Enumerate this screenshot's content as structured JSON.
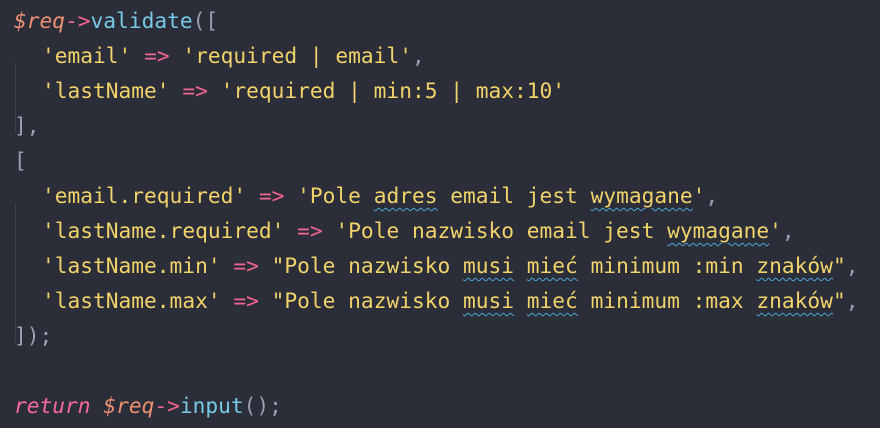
{
  "code": {
    "l1": {
      "var": "$req",
      "arrow": "->",
      "method": "validate",
      "open": "(["
    },
    "l2": {
      "key": "'email'",
      "arrow": "=>",
      "value": "'required | email'",
      "comma": ","
    },
    "l3": {
      "key": "'lastName'",
      "arrow": "=>",
      "value": "'required | min:5 | max:10'"
    },
    "l4": {
      "close": "],"
    },
    "l5": {
      "open": "["
    },
    "l6": {
      "key": "'email.required'",
      "arrow": "=>",
      "value_pre": "'Pole ",
      "value_sq1": "adres",
      "value_mid": " email jest ",
      "value_sq2": "wymagane",
      "value_end": "'",
      "comma": ","
    },
    "l7": {
      "key": "'lastName.required'",
      "arrow": "=>",
      "value_pre": "'Pole nazwisko email jest ",
      "value_sq1": "wymagane",
      "value_end": "'",
      "comma": ","
    },
    "l8": {
      "key": "'lastName.min'",
      "arrow": "=>",
      "value_pre": "\"Pole nazwisko ",
      "value_sq1": "musi",
      "value_sp1": " ",
      "value_sq2": "mieć",
      "value_mid": " minimum :min ",
      "value_sq3": "znaków",
      "value_end": "\"",
      "comma": ","
    },
    "l9": {
      "key": "'lastName.max'",
      "arrow": "=>",
      "value_pre": "\"Pole nazwisko ",
      "value_sq1": "musi",
      "value_sp1": " ",
      "value_sq2": "mieć",
      "value_mid": " minimum :max ",
      "value_sq3": "znaków",
      "value_end": "\"",
      "comma": ","
    },
    "l10": {
      "close": "]);"
    },
    "l12": {
      "keyword": "return",
      "var": "$req",
      "arrow": "->",
      "method": "input",
      "call": "();"
    }
  }
}
